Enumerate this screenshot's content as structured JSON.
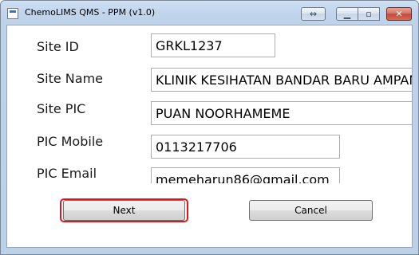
{
  "window": {
    "title": "ChemoLIMS QMS - PPM (v1.0)",
    "controls": {
      "resize": "⇔",
      "minimize": "▁",
      "maximize": "▫",
      "close": "✕"
    }
  },
  "form": {
    "fields": [
      {
        "label": "Site ID",
        "value": "GRKL1237"
      },
      {
        "label": "Site Name",
        "value": "KLINIK KESIHATAN BANDAR BARU AMPANG"
      },
      {
        "label": "Site PIC",
        "value": "PUAN NOORHAMEME"
      },
      {
        "label": "PIC Mobile",
        "value": "0113217706"
      },
      {
        "label": "PIC Email",
        "value": "memeharun86@gmail.com"
      }
    ]
  },
  "actions": {
    "next_label": "Next",
    "cancel_label": "Cancel"
  },
  "colors": {
    "focus_outline": "#e0161a",
    "title_bar": "#bfd3eb",
    "close_button": "#c4483b"
  }
}
